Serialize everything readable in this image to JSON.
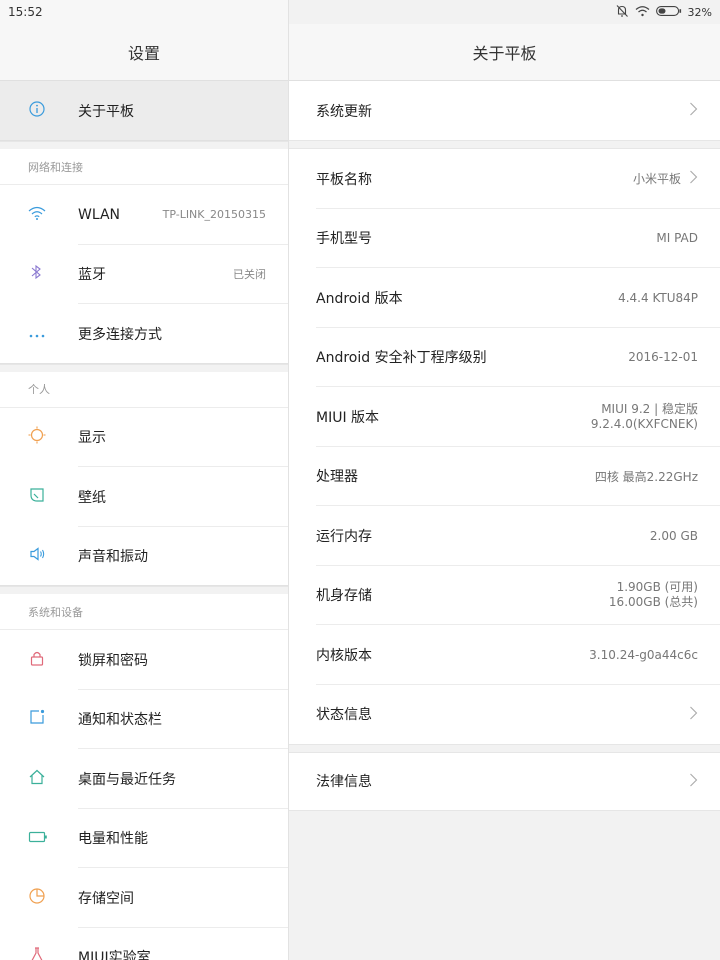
{
  "status": {
    "time": "15:52",
    "battery": "32%"
  },
  "left": {
    "title": "设置",
    "selected": {
      "label": "关于平板",
      "icon": "info-icon"
    },
    "sections": [
      {
        "title": "网络和连接",
        "items": [
          {
            "label": "WLAN",
            "value": "TP-LINK_20150315",
            "icon": "wifi-icon"
          },
          {
            "label": "蓝牙",
            "value": "已关闭",
            "icon": "bluetooth-icon"
          },
          {
            "label": "更多连接方式",
            "value": "",
            "icon": "more-dots-icon"
          }
        ]
      },
      {
        "title": "个人",
        "items": [
          {
            "label": "显示",
            "icon": "brightness-icon"
          },
          {
            "label": "壁纸",
            "icon": "wallpaper-icon"
          },
          {
            "label": "声音和振动",
            "icon": "speaker-icon"
          }
        ]
      },
      {
        "title": "系统和设备",
        "items": [
          {
            "label": "锁屏和密码",
            "icon": "lock-icon"
          },
          {
            "label": "通知和状态栏",
            "icon": "notification-icon"
          },
          {
            "label": "桌面与最近任务",
            "icon": "home-icon"
          },
          {
            "label": "电量和性能",
            "icon": "battery-icon"
          },
          {
            "label": "存储空间",
            "icon": "storage-pie-icon"
          },
          {
            "label": "MIUI实验室",
            "icon": "lab-flask-icon"
          }
        ]
      }
    ]
  },
  "right": {
    "title": "关于平板",
    "system_update": "系统更新",
    "rows": [
      {
        "label": "平板名称",
        "value": "小米平板"
      },
      {
        "label": "手机型号",
        "value": "MI PAD"
      },
      {
        "label": "Android 版本",
        "value": "4.4.4 KTU84P"
      },
      {
        "label": "Android 安全补丁程序级别",
        "value": "2016-12-01"
      },
      {
        "label": "MIUI 版本",
        "value": "MIUI 9.2 | 稳定版",
        "value2": "9.2.4.0(KXFCNEK)"
      },
      {
        "label": "处理器",
        "value": "四核 最高2.22GHz"
      },
      {
        "label": "运行内存",
        "value": "2.00 GB"
      },
      {
        "label": "机身存储",
        "value": "1.90GB (可用)",
        "value2": "16.00GB (总共)"
      },
      {
        "label": "内核版本",
        "value": "3.10.24-g0a44c6c"
      },
      {
        "label": "状态信息",
        "value": ""
      }
    ],
    "legal": "法律信息"
  }
}
